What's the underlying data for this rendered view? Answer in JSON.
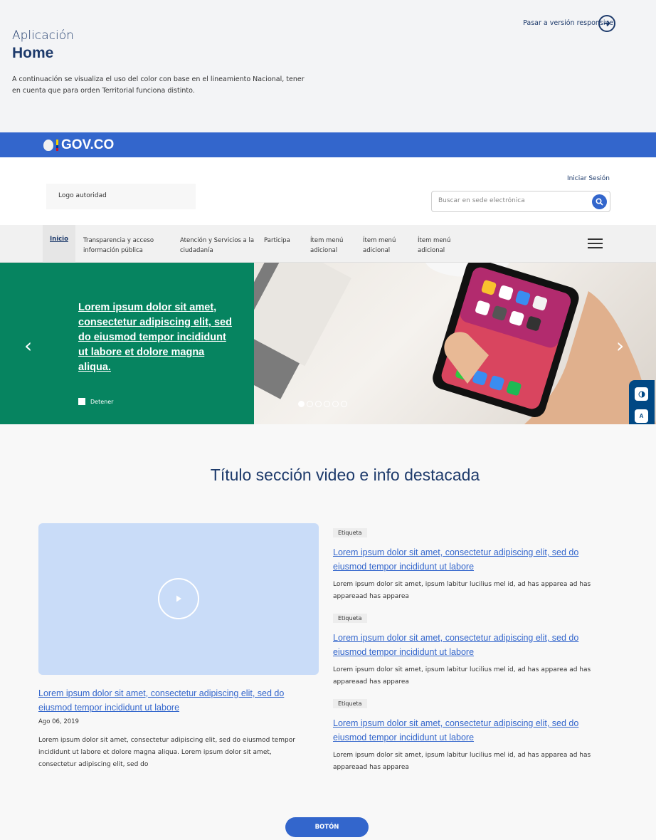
{
  "intro": {
    "app_label": "Aplicación",
    "page_label": "Home",
    "description": "A continuación se visualiza el uso del color con base en el lineamiento Nacional, tener en cuenta que para orden Territorial funciona distinto.",
    "responsive_link": "Pasar a versión responsive"
  },
  "gov": {
    "brand": "GOV.CO"
  },
  "header": {
    "authority_logo": "Logo autoridad",
    "login": "Iniciar Sesión",
    "search_placeholder": "Buscar en sede electrónica"
  },
  "nav": {
    "items": [
      "Inicio",
      "Transparencia y acceso información pública",
      "Atención y Servicios a la ciudadanía",
      "Participa",
      "Ítem menú adicional",
      "Ítem menú adicional",
      "Ítem menú adicional"
    ]
  },
  "hero": {
    "title": "Lorem ipsum dolor sit amet, consectetur adipiscing elit, sed do eiusmod tempor incididunt ut labore et dolore magna aliqua.",
    "stop": "Detener",
    "slides": 6,
    "active_slide": 1
  },
  "accessibility": {
    "size_small": "A",
    "size_large": "A"
  },
  "section": {
    "title": "Título sección video e info destacada",
    "main": {
      "link": "Lorem ipsum dolor sit amet, consectetur adipiscing elit, sed do eiusmod tempor incididunt ut labore",
      "date": "Ago 06, 2019",
      "body": "Lorem ipsum dolor sit amet, consectetur adipiscing elit, sed do eiusmod tempor incididunt ut labore et dolore magna aliqua. Lorem ipsum dolor sit amet, consectetur adipiscing elit, sed do"
    },
    "news": [
      {
        "tag": "Etiqueta",
        "link": "Lorem ipsum dolor sit amet, consectetur adipiscing elit, sed do eiusmod tempor incididunt ut labore",
        "text": "Lorem ipsum dolor sit amet, ipsum labitur lucilius mel id, ad has apparea ad has appareaad has apparea"
      },
      {
        "tag": "Etiqueta",
        "link": "Lorem ipsum dolor sit amet, consectetur adipiscing elit, sed do eiusmod tempor incididunt ut labore",
        "text": "Lorem ipsum dolor sit amet, ipsum labitur lucilius mel id, ad has apparea ad has appareaad has apparea"
      },
      {
        "tag": "Etiqueta",
        "link": "Lorem ipsum dolor sit amet, consectetur adipiscing elit, sed do eiusmod tempor incididunt ut labore",
        "text": "Lorem ipsum dolor sit amet, ipsum labitur lucilius mel id, ad has apparea ad has appareaad has apparea"
      }
    ],
    "button": "BOTÓN"
  },
  "colors": {
    "gov_blue": "#3366cc",
    "hero_green": "#068460",
    "title_navy": "#1d3a6b",
    "accessibility_bar": "#004884",
    "video_bg": "#c9dcf8"
  }
}
